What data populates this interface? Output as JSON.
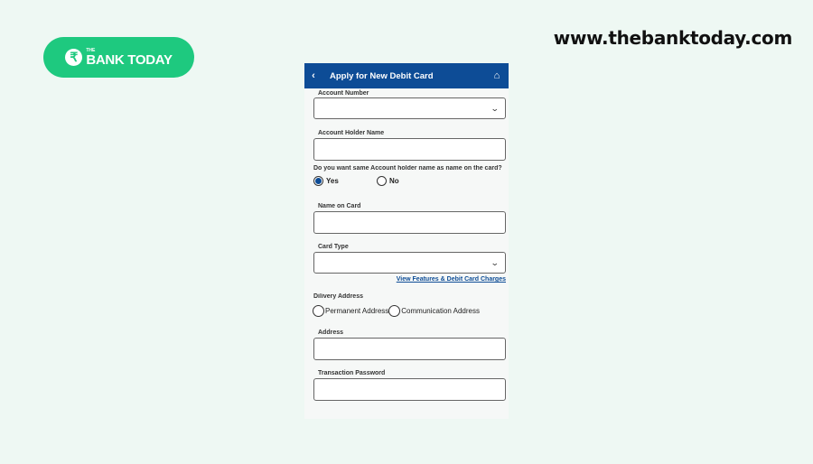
{
  "brand": {
    "logo_small": "THE",
    "logo_main": "BANK TODAY",
    "logo_icon": "rupee-icon",
    "website": "www.thebanktoday.com",
    "accent": "#1ec97f"
  },
  "app": {
    "header": {
      "title": "Apply for New Debit Card",
      "back_icon": "chevron-left-icon",
      "home_icon": "home-icon",
      "color": "#0d4c96"
    },
    "fields": {
      "account_number": {
        "label": "Account Number",
        "value": ""
      },
      "account_holder_name": {
        "label": "Account Holder Name",
        "value": ""
      },
      "same_name_question": "Do you want same Account holder name as name on the card?",
      "same_name_options": [
        {
          "label": "Yes",
          "selected": true
        },
        {
          "label": "No",
          "selected": false
        }
      ],
      "name_on_card": {
        "label": "Name on Card",
        "value": ""
      },
      "card_type": {
        "label": "Card Type",
        "value": ""
      },
      "features_link": "View Features & Debit Card Charges",
      "delivery_address_label": "Dilivery Address",
      "delivery_options": [
        {
          "label": "Permanent Address",
          "selected": false
        },
        {
          "label": "Communication Address",
          "selected": false
        }
      ],
      "address": {
        "label": "Address",
        "value": ""
      },
      "transaction_password": {
        "label": "Transaction Password",
        "value": ""
      }
    }
  }
}
